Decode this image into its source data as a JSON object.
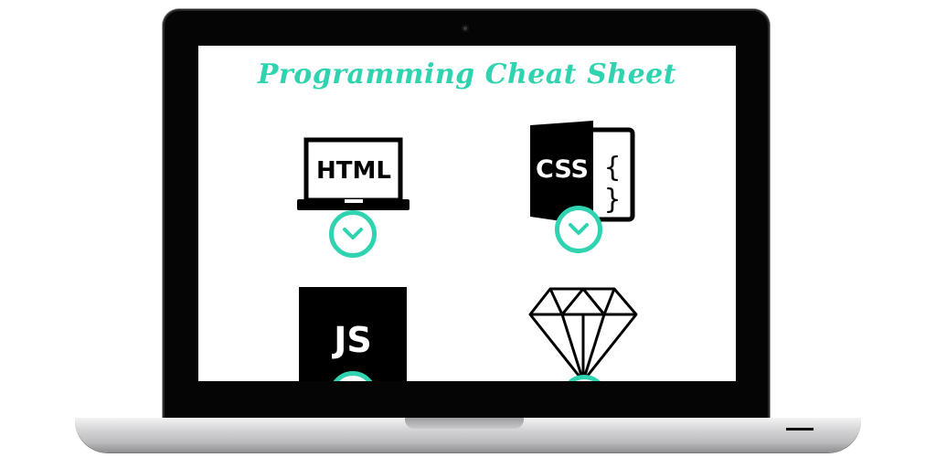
{
  "page": {
    "title": "Programming Cheat Sheet",
    "accent_color": "#2fd3b0"
  },
  "tiles": [
    {
      "label": "HTML",
      "icon": "laptop-html-icon",
      "action_icon": "chevron-down-icon"
    },
    {
      "label": "CSS",
      "icon": "css-document-braces-icon",
      "action_icon": "chevron-down-icon"
    },
    {
      "label": "JS",
      "icon": "js-square-icon",
      "action_icon": "chevron-down-icon"
    },
    {
      "label": "",
      "icon": "diamond-icon",
      "action_icon": "chevron-down-icon"
    }
  ],
  "css_braces": "{ }"
}
